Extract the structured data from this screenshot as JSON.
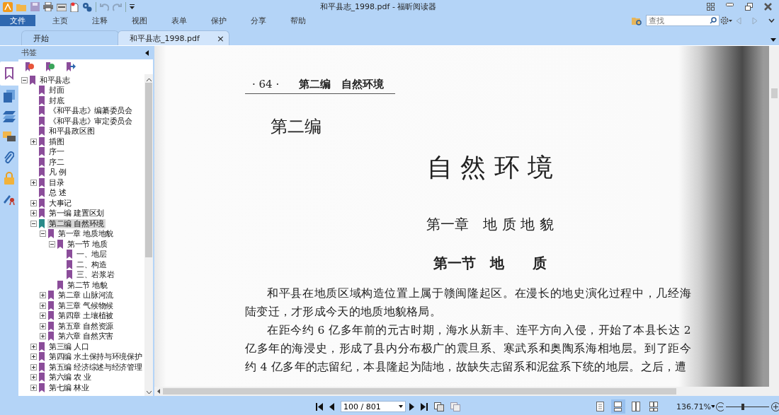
{
  "window": {
    "title": "和平县志_1998.pdf - 福昕阅读器"
  },
  "menu": [
    {
      "label": "文件",
      "selected": true
    },
    {
      "label": "主页",
      "selected": false
    },
    {
      "label": "注释",
      "selected": false
    },
    {
      "label": "视图",
      "selected": false
    },
    {
      "label": "表单",
      "selected": false
    },
    {
      "label": "保护",
      "selected": false
    },
    {
      "label": "分享",
      "selected": false
    },
    {
      "label": "帮助",
      "selected": false
    }
  ],
  "search": {
    "placeholder": "查找"
  },
  "tabs": [
    {
      "label": "开始",
      "selected": false
    },
    {
      "label": "和平县志_1998.pdf",
      "selected": true,
      "close": "×"
    }
  ],
  "side_tools": [
    {
      "kind": "bookmarks",
      "selected": true
    },
    {
      "kind": "pages",
      "selected": false
    },
    {
      "kind": "layers",
      "selected": false
    },
    {
      "kind": "comments",
      "selected": false
    },
    {
      "kind": "attachments",
      "selected": false
    },
    {
      "kind": "security",
      "selected": false
    },
    {
      "kind": "signatures",
      "selected": false
    }
  ],
  "bookmarks": {
    "title": "书签",
    "items": [
      {
        "label": "和平县志",
        "kind": "group",
        "expanded": true,
        "selected": false,
        "children": [
          {
            "label": "封面",
            "kind": "leaf",
            "selected": false
          },
          {
            "label": "封底",
            "kind": "leaf",
            "selected": false
          },
          {
            "label": "《和平县志》编纂委员会",
            "kind": "leaf",
            "selected": false
          },
          {
            "label": "《和平县志》审定委员会",
            "kind": "leaf",
            "selected": false
          },
          {
            "label": "和平县政区图",
            "kind": "leaf",
            "selected": false
          },
          {
            "label": "插图",
            "kind": "group",
            "expanded": false,
            "selected": false
          },
          {
            "label": "序一",
            "kind": "leaf",
            "selected": false
          },
          {
            "label": "序二",
            "kind": "leaf",
            "selected": false
          },
          {
            "label": "凡 例",
            "kind": "leaf",
            "selected": false
          },
          {
            "label": "目录",
            "kind": "group",
            "expanded": false,
            "selected": false
          },
          {
            "label": "总 述",
            "kind": "leaf",
            "selected": false
          },
          {
            "label": "大事记",
            "kind": "group",
            "expanded": false,
            "selected": false
          },
          {
            "label": "第一编 建置区划",
            "kind": "group",
            "expanded": false,
            "selected": false
          },
          {
            "label": "第二编 自然环境",
            "kind": "group",
            "expanded": true,
            "selected": true,
            "children": [
              {
                "label": "第一章 地质地貌",
                "kind": "group",
                "expanded": true,
                "selected": false,
                "children": [
                  {
                    "label": "第一节 地质",
                    "kind": "group",
                    "expanded": true,
                    "selected": false,
                    "children": [
                      {
                        "label": "一、地层",
                        "kind": "leaf",
                        "selected": false
                      },
                      {
                        "label": "二、构造",
                        "kind": "leaf",
                        "selected": false
                      },
                      {
                        "label": "三、岩浆岩",
                        "kind": "leaf",
                        "selected": false
                      }
                    ]
                  },
                  {
                    "label": "第二节 地貌",
                    "kind": "leaf",
                    "selected": false
                  }
                ]
              },
              {
                "label": "第二章 山脉河流",
                "kind": "group",
                "expanded": false,
                "selected": false
              },
              {
                "label": "第三章 气候物候",
                "kind": "group",
                "expanded": false,
                "selected": false
              },
              {
                "label": "第四章 土壤植被",
                "kind": "group",
                "expanded": false,
                "selected": false
              },
              {
                "label": "第五章 自然资源",
                "kind": "group",
                "expanded": false,
                "selected": false
              },
              {
                "label": "第六章 自然灾害",
                "kind": "group",
                "expanded": false,
                "selected": false
              }
            ]
          },
          {
            "label": "第三编 人口",
            "kind": "group",
            "expanded": false,
            "selected": false
          },
          {
            "label": "第四编 水土保持与环境保护",
            "kind": "group",
            "expanded": false,
            "selected": false
          },
          {
            "label": "第五编 经济综述与经济管理",
            "kind": "group",
            "expanded": false,
            "selected": false
          },
          {
            "label": "第六编 农 业",
            "kind": "group",
            "expanded": false,
            "selected": false
          },
          {
            "label": "第七编 林业",
            "kind": "group",
            "expanded": false,
            "selected": false
          }
        ]
      }
    ]
  },
  "page": {
    "running_head_number": "· 64 ·",
    "running_head_title": "第二编　自然环境",
    "part": "第二编",
    "part_title": "自 然 环 境",
    "chapter": "第一章　地 质 地 貌",
    "section": "第一节　地　　质",
    "paragraphs": [
      "和平县在地质区域构造位置上属于赣闽隆起区。在漫长的地史演化过程中，几经海陆变迁，才形成今天的地质地貌格局。",
      "在距今约 6 亿多年前的元古时期，海水从新丰、连平方向入侵，开始了本县长达 2 亿多年的海浸史，形成了县内分布极广的震旦系、寒武系和奥陶系海相地层。到了距今约 4 亿多年的志留纪，本县隆起为陆地，故缺失志留系和泥盆系下统的地层。之后，遭"
    ]
  },
  "status_bar": {
    "page_field": "100 / 801",
    "view_modes": [
      {
        "kind": "single",
        "selected": false
      },
      {
        "kind": "continuous",
        "selected": true
      },
      {
        "kind": "facing",
        "selected": false
      },
      {
        "kind": "continuous-facing",
        "selected": false
      }
    ],
    "zoom": "136.71%",
    "zoom_slider": {
      "level": 0.4
    }
  }
}
